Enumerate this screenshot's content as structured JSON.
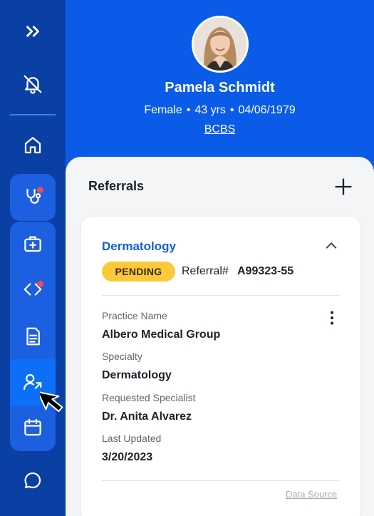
{
  "sidebar": {
    "items": [
      {
        "name": "expand-icon",
        "badge": false
      },
      {
        "name": "bell-off-icon",
        "badge": false
      },
      {
        "name": "home-icon",
        "badge": false
      },
      {
        "name": "stethoscope-icon",
        "badge": true
      },
      {
        "name": "medical-kit-icon",
        "badge": false
      },
      {
        "name": "code-icon",
        "badge": true
      },
      {
        "name": "document-icon",
        "badge": false
      },
      {
        "name": "referral-icon",
        "badge": false,
        "active": true
      },
      {
        "name": "calendar-icon",
        "badge": false
      },
      {
        "name": "chat-icon",
        "badge": false
      }
    ],
    "badge_color": "#f04a5a",
    "active_color": "#0c6ff5"
  },
  "patient": {
    "name": "Pamela Schmidt",
    "gender": "Female",
    "age": "43 yrs",
    "dob": "04/06/1979",
    "separator": "•",
    "insurance": "BCBS"
  },
  "referrals": {
    "title": "Referrals",
    "add_icon": "plus-icon",
    "card": {
      "title": "Dermatology",
      "status": "PENDING",
      "status_color": "#fcc93a",
      "referral_label": "Referral#",
      "referral_number": "A99323-55",
      "fields": [
        {
          "label": "Practice Name",
          "value": "Albero Medical Group"
        },
        {
          "label": "Specialty",
          "value": "Dermatology"
        },
        {
          "label": "Requested Specialist",
          "value": "Dr. Anita Alvarez"
        },
        {
          "label": "Last Updated",
          "value": "3/20/2023"
        }
      ],
      "data_source": "Data Source"
    }
  },
  "colors": {
    "header_blue": "#0a5ce8",
    "sidebar_blue": "#0a3fa3",
    "accent_blue": "#1160dc"
  }
}
